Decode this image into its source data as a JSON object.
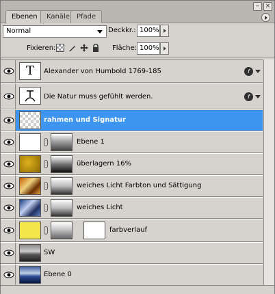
{
  "tabs": [
    {
      "label": "Ebenen",
      "active": true
    },
    {
      "label": "Kanäle",
      "active": false
    },
    {
      "label": "Pfade",
      "active": false
    }
  ],
  "window": {
    "minimize_icon": "minimize-icon",
    "close_icon": "close-icon",
    "menu_icon": "panel-menu-icon"
  },
  "blend_mode": "Normal",
  "opacity": {
    "label": "Deckkr.:",
    "value": "100%"
  },
  "lock": {
    "label": "Fixieren:"
  },
  "fill": {
    "label": "Fläche:",
    "value": "100%"
  },
  "colors": {
    "selection": "#3d95f0",
    "panel": "#d6d3ce"
  },
  "layers": [
    {
      "name": "Alexander von Humbold 1769-185",
      "type": "text",
      "effects": true
    },
    {
      "name": "Die Natur muss gefühlt werden.",
      "type": "text-signature",
      "effects": true
    },
    {
      "name": "rahmen und Signatur",
      "type": "transparent",
      "selected": true
    },
    {
      "name": "Ebene 1",
      "type": "masked-white"
    },
    {
      "name": "überlagern 16%",
      "type": "masked-gold"
    },
    {
      "name": "weiches Licht Farbton und Sättigung",
      "type": "masked-orange"
    },
    {
      "name": "weiches Licht",
      "type": "masked-blue"
    },
    {
      "name": "farbverlauf",
      "type": "gradient-yellow"
    },
    {
      "name": "SW",
      "type": "photo-bw"
    },
    {
      "name": "Ebene 0",
      "type": "photo-color"
    }
  ]
}
